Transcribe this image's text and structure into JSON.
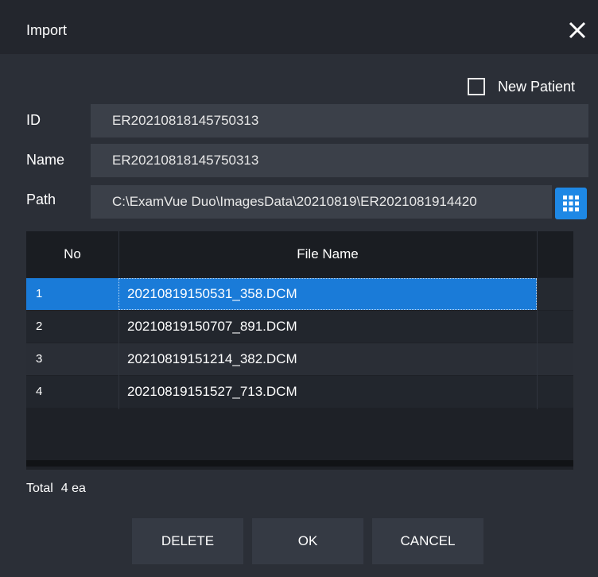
{
  "dialog": {
    "title": "Import",
    "close_icon": "close-icon"
  },
  "new_patient": {
    "label": "New Patient",
    "checked": false
  },
  "fields": {
    "id": {
      "label": "ID",
      "value": "ER20210818145750313"
    },
    "name": {
      "label": "Name",
      "value": "ER20210818145750313"
    },
    "path": {
      "label": "Path",
      "value": "C:\\ExamVue Duo\\ImagesData\\20210819\\ER2021081914420"
    }
  },
  "browse_icon": "grid-icon",
  "table": {
    "headers": [
      "No",
      "File Name"
    ],
    "rows": [
      {
        "no": "1",
        "file": "20210819150531_358.DCM",
        "selected": true
      },
      {
        "no": "2",
        "file": "20210819150707_891.DCM",
        "selected": false
      },
      {
        "no": "3",
        "file": "20210819151214_382.DCM",
        "selected": false
      },
      {
        "no": "4",
        "file": "20210819151527_713.DCM",
        "selected": false
      }
    ]
  },
  "total": {
    "label": "Total",
    "count": "4 ea"
  },
  "buttons": {
    "delete": "DELETE",
    "ok": "OK",
    "cancel": "CANCEL"
  },
  "colors": {
    "accent": "#1a7bd8",
    "browse_button": "#1e88e5",
    "background": "#2b2f37",
    "titlebar": "#23262d"
  }
}
